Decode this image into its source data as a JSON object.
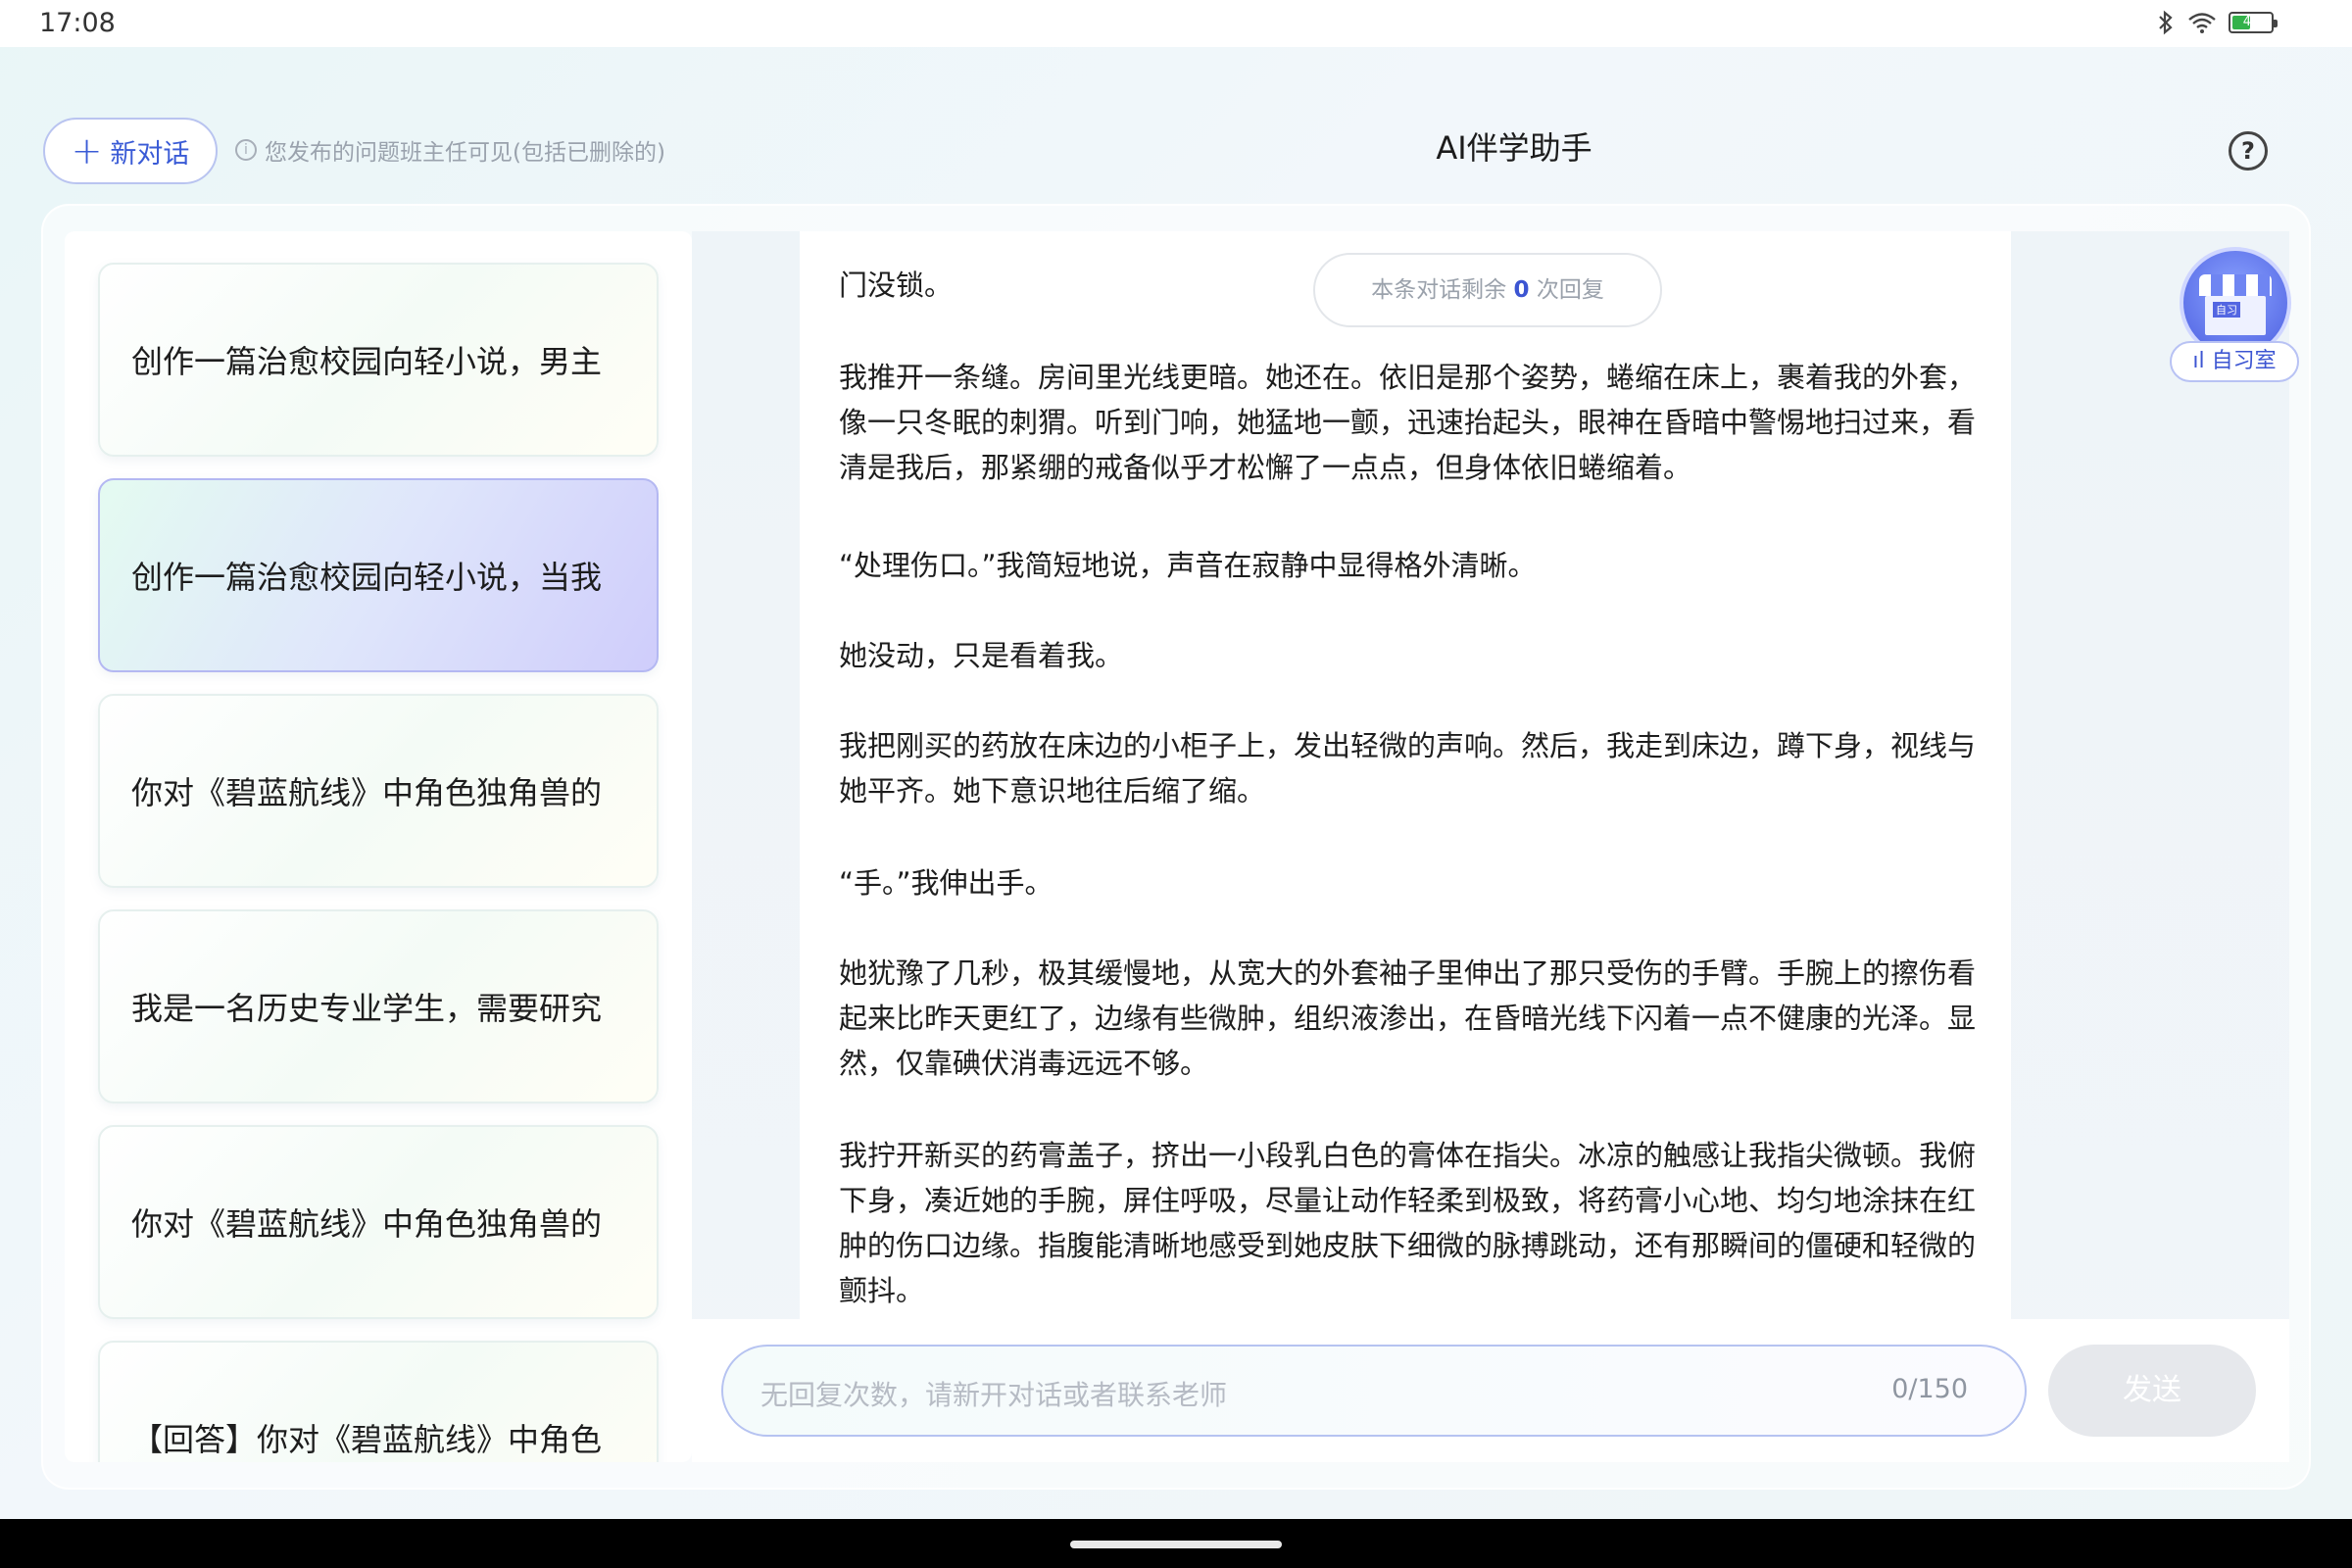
{
  "status_bar": {
    "time": "17:08",
    "battery_level": "44",
    "icons": [
      "bluetooth-icon",
      "wifi-icon",
      "battery-icon"
    ]
  },
  "header": {
    "new_chat_label": "新对话",
    "hint": "您发布的问题班主任可见(包括已删除的)",
    "title": "AI伴学助手"
  },
  "sidebar": {
    "items": [
      {
        "label": "创作一篇治愈校园向轻小说，男主",
        "active": false
      },
      {
        "label": "创作一篇治愈校园向轻小说，当我",
        "active": true
      },
      {
        "label": "你对《碧蓝航线》中角色独角兽的",
        "active": false
      },
      {
        "label": "我是一名历史专业学生，需要研究",
        "active": false
      },
      {
        "label": "你对《碧蓝航线》中角色独角兽的",
        "active": false
      },
      {
        "label": "【回答】你对《碧蓝航线》中角色",
        "active": false
      }
    ]
  },
  "conversation": {
    "remaining_prefix": "本条对话剩余",
    "remaining_count": "0",
    "remaining_suffix": "次回复",
    "paragraphs": [
      "门没锁。",
      "我推开一条缝。房间里光线更暗。她还在。依旧是那个姿势，蜷缩在床上，裹着我的外套，像一只冬眠的刺猬。听到门响，她猛地一颤，迅速抬起头，眼神在昏暗中警惕地扫过来，看清是我后，那紧绷的戒备似乎才松懈了一点点，但身体依旧蜷缩着。",
      "“处理伤口。”我简短地说，声音在寂静中显得格外清晰。",
      "她没动，只是看着我。",
      "我把刚买的药放在床边的小柜子上，发出轻微的声响。然后，我走到床边，蹲下身，视线与她平齐。她下意识地往后缩了缩。",
      "“手。”我伸出手。",
      "她犹豫了几秒，极其缓慢地，从宽大的外套袖子里伸出了那只受伤的手臂。手腕上的擦伤看起来比昨天更红了，边缘有些微肿，组织液渗出，在昏暗光线下闪着一点不健康的光泽。显然，仅靠碘伏消毒远远不够。",
      "我拧开新买的药膏盖子，挤出一小段乳白色的膏体在指尖。冰凉的触感让我指尖微顿。我俯下身，凑近她的手腕，屏住呼吸，尽量让动作轻柔到极致，将药膏小心地、均匀地涂抹在红肿的伤口边缘。指腹能清晰地感受到她皮肤下细微的脉搏跳动，还有那瞬间的僵硬和轻微的颤抖。"
    ]
  },
  "study_room": {
    "label": "自习室",
    "sign": "自习"
  },
  "composer": {
    "placeholder": "无回复次数，请新开对话或者联系老师",
    "counter": "0/150",
    "send_label": "发送"
  }
}
